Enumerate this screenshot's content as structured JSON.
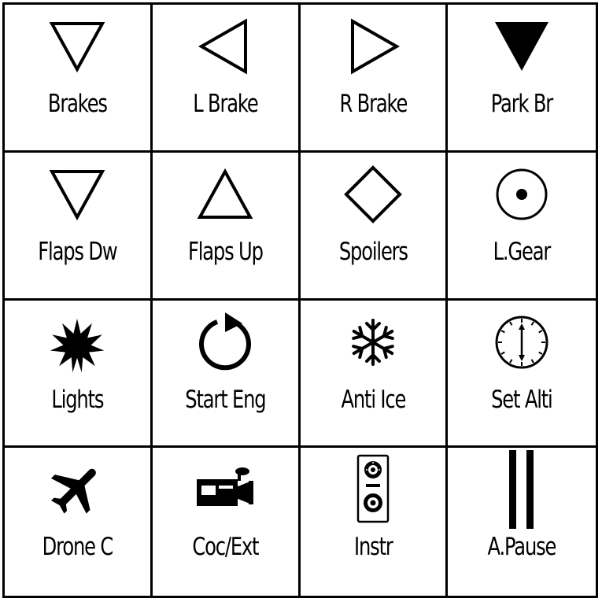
{
  "buttons": [
    {
      "label": "Brakes"
    },
    {
      "label": "L Brake"
    },
    {
      "label": "R Brake"
    },
    {
      "label": "Park Br"
    },
    {
      "label": "Flaps Dw"
    },
    {
      "label": "Flaps Up"
    },
    {
      "label": "Spoilers"
    },
    {
      "label": "L.Gear"
    },
    {
      "label": "Lights"
    },
    {
      "label": "Start Eng"
    },
    {
      "label": "Anti Ice"
    },
    {
      "label": "Set Alti"
    },
    {
      "label": "Drone C"
    },
    {
      "label": "Coc/Ext"
    },
    {
      "label": "Instr"
    },
    {
      "label": "A.Pause"
    }
  ]
}
